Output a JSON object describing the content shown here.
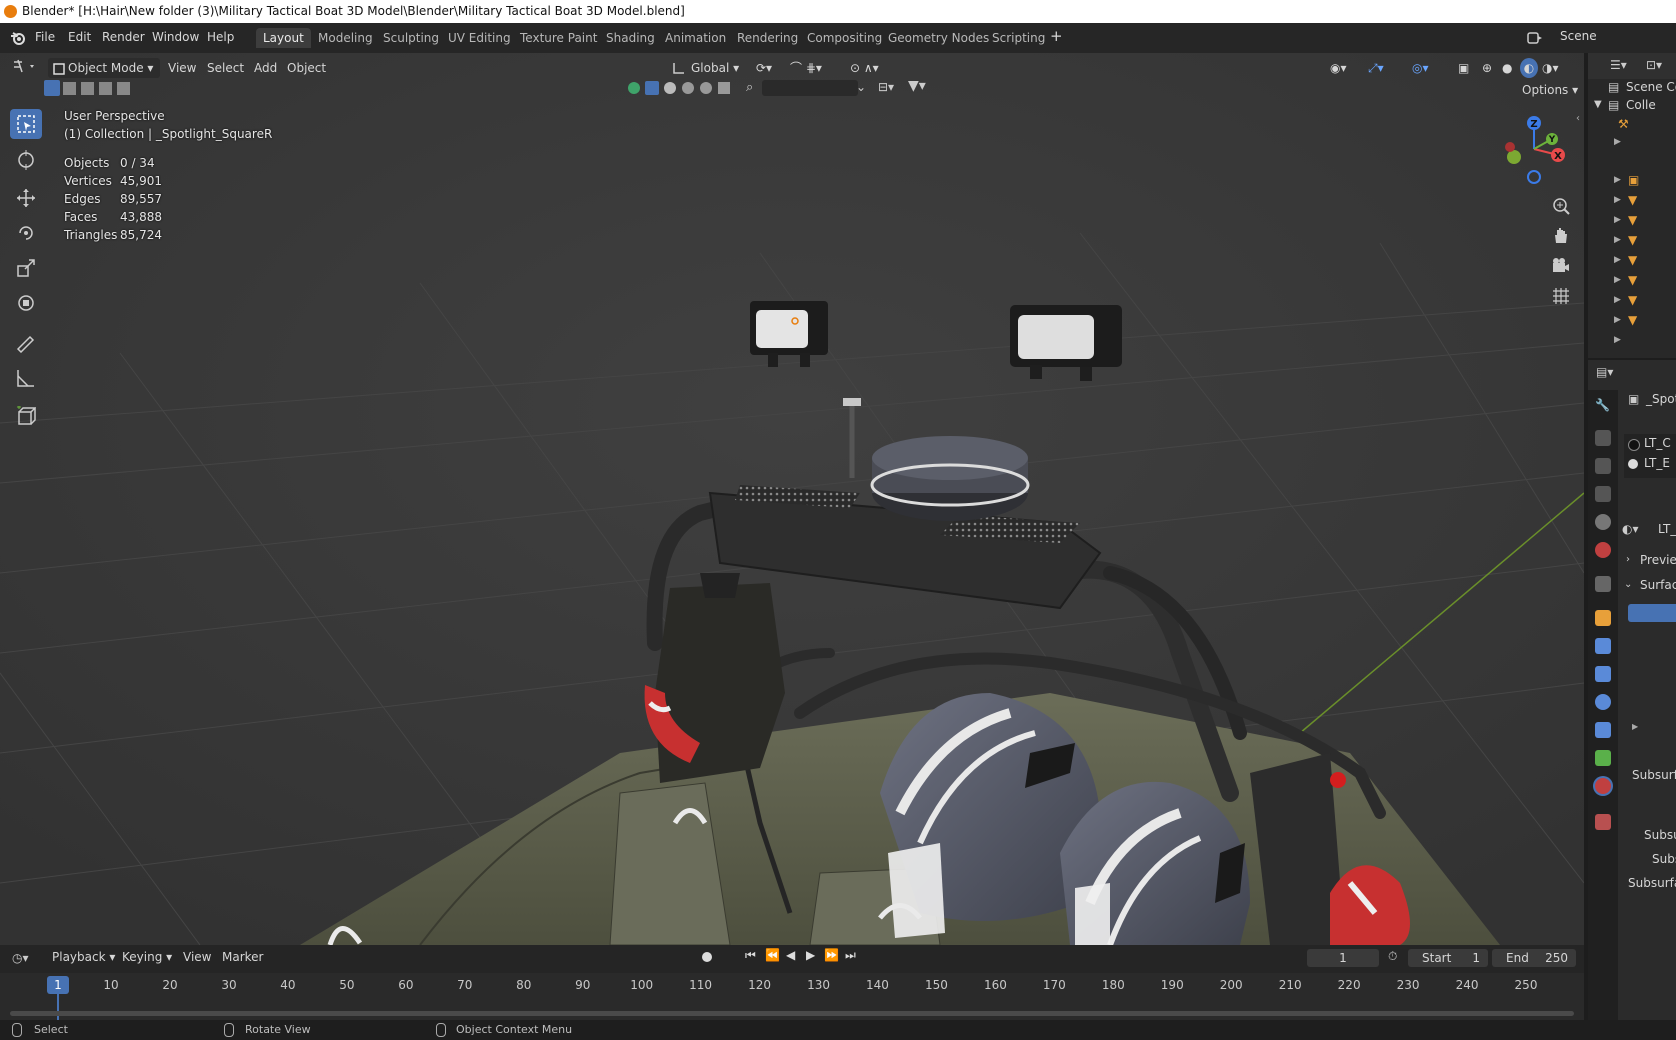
{
  "title_bar": {
    "text": "Blender* [H:\\Hair\\New folder (3)\\Military Tactical Boat 3D Model\\Blender\\Military Tactical Boat 3D Model.blend]"
  },
  "menu": {
    "items": [
      "File",
      "Edit",
      "Render",
      "Window",
      "Help"
    ]
  },
  "workspaces": {
    "tabs": [
      "Layout",
      "Modeling",
      "Sculpting",
      "UV Editing",
      "Texture Paint",
      "Shading",
      "Animation",
      "Rendering",
      "Compositing",
      "Geometry Nodes",
      "Scripting"
    ],
    "active": "Layout"
  },
  "scene": {
    "name": "Scene"
  },
  "viewport_header": {
    "mode": "Object Mode",
    "menus": [
      "View",
      "Select",
      "Add",
      "Object"
    ],
    "orientation": "Global",
    "options_label": "Options"
  },
  "viewport_overlay": {
    "perspective": "User Perspective",
    "collection": "(1) Collection | _Spotlight_SquareR",
    "stats": [
      {
        "label": "Objects",
        "value": "0 / 34"
      },
      {
        "label": "Vertices",
        "value": "45,901"
      },
      {
        "label": "Edges",
        "value": "89,557"
      },
      {
        "label": "Faces",
        "value": "43,888"
      },
      {
        "label": "Triangles",
        "value": "85,724"
      }
    ]
  },
  "gizmo": {
    "z": "Z",
    "y": "Y",
    "x": "X"
  },
  "outliner": {
    "scene_collection": "Scene Co",
    "collection": "Colle"
  },
  "properties": {
    "object": "_Spot",
    "materials": [
      "LT_C",
      "LT_E"
    ],
    "material_name": "LT_",
    "sections": [
      "Previe",
      "Surfac"
    ],
    "subsurface": [
      "Subsurf",
      "Subsu",
      "Subs",
      "Subsurfa"
    ]
  },
  "timeline": {
    "menus": [
      "Playback",
      "Keying",
      "View",
      "Marker"
    ],
    "current_frame": "1",
    "start_label": "Start",
    "start": "1",
    "end_label": "End",
    "end": "250",
    "ticks": [
      "1",
      "10",
      "20",
      "30",
      "40",
      "50",
      "60",
      "70",
      "80",
      "90",
      "100",
      "110",
      "120",
      "130",
      "140",
      "150",
      "160",
      "170",
      "180",
      "190",
      "200",
      "210",
      "220",
      "230",
      "240",
      "250"
    ]
  },
  "status_bar": {
    "select": "Select",
    "rotate": "Rotate View",
    "context": "Object Context Menu"
  },
  "colors": {
    "accent": "#4772b3",
    "viewport_bg": "#3b3b3b",
    "panel": "#282828",
    "x_axis": "#e84a4a",
    "y_axis": "#6cb23b",
    "z_axis": "#3b7be8"
  }
}
